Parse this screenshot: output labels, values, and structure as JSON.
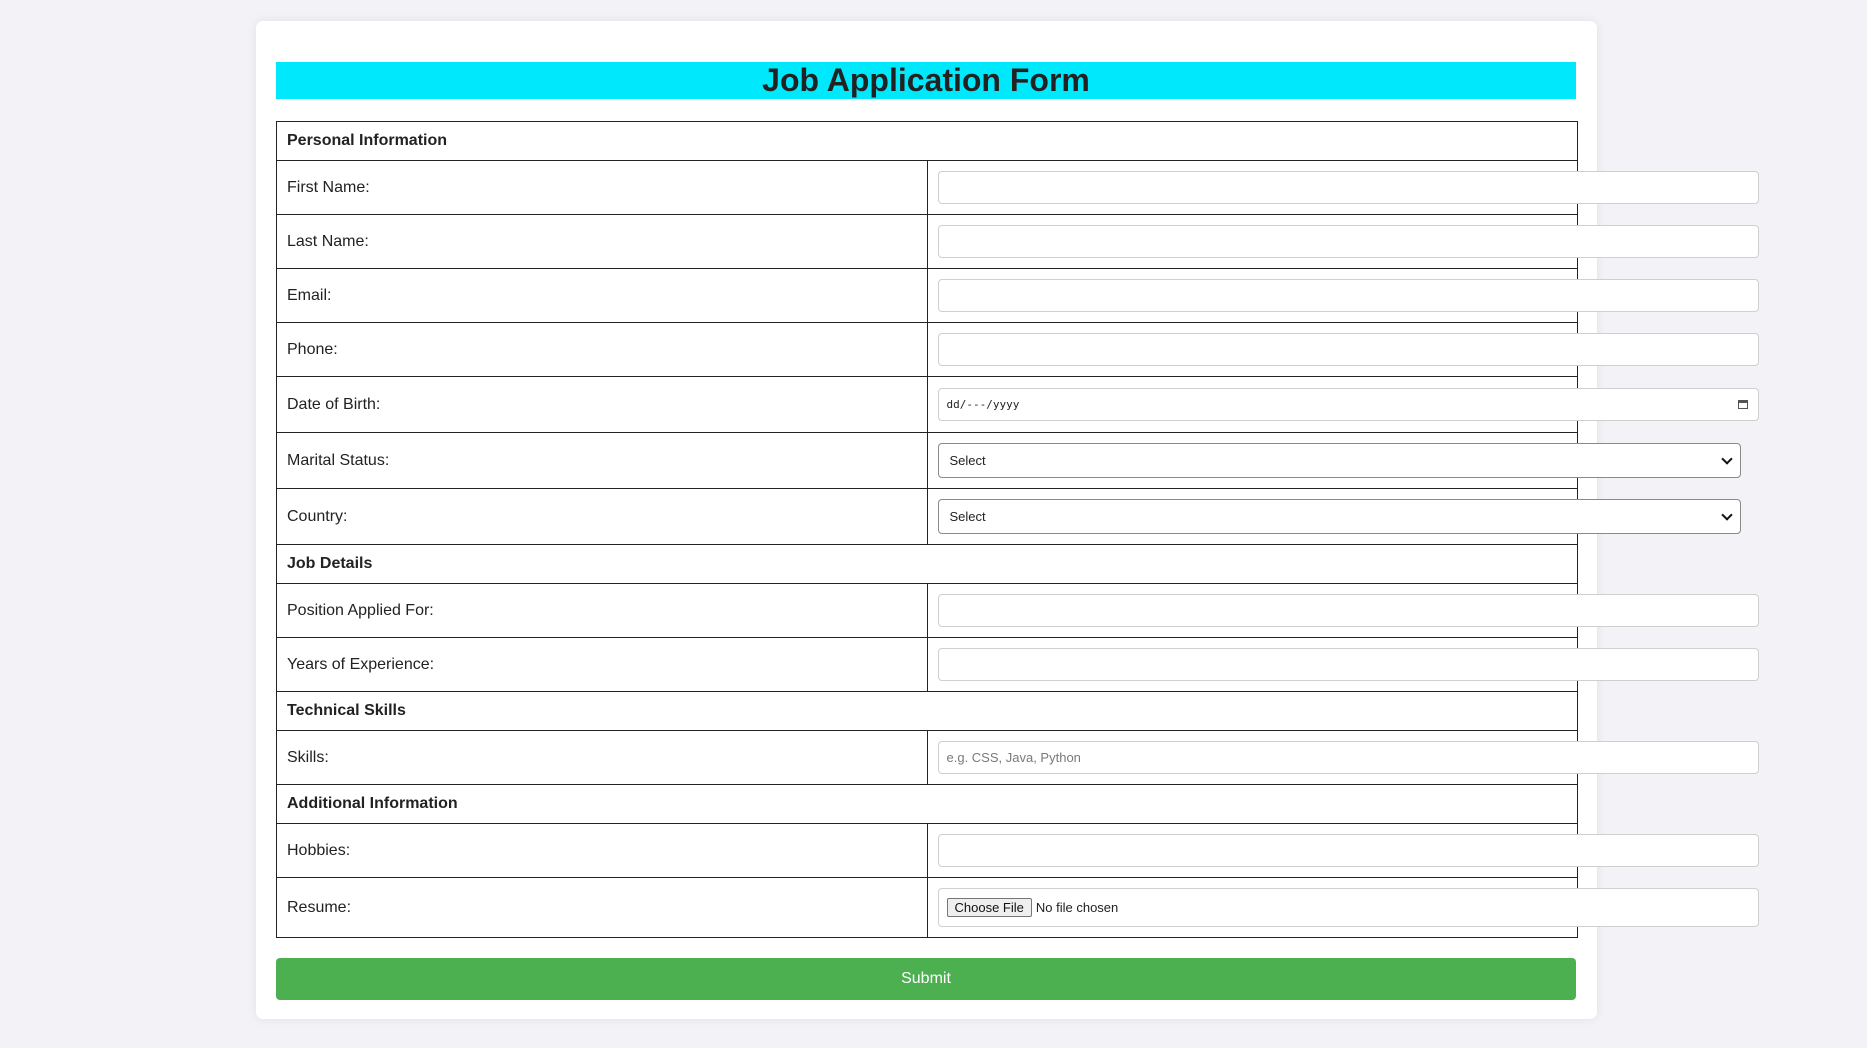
{
  "form": {
    "title": "Job Application Form",
    "submit_label": "Submit"
  },
  "sections": {
    "personal": "Personal Information",
    "job": "Job Details",
    "technical": "Technical Skills",
    "additional": "Additional Information"
  },
  "fields": {
    "first_name": {
      "label": "First Name:",
      "value": ""
    },
    "last_name": {
      "label": "Last Name:",
      "value": ""
    },
    "email": {
      "label": "Email:",
      "value": ""
    },
    "phone": {
      "label": "Phone:",
      "value": ""
    },
    "dob": {
      "label": "Date of Birth:",
      "placeholder": "dd/---/yyyy"
    },
    "marital_status": {
      "label": "Marital Status:",
      "selected": "Select"
    },
    "country": {
      "label": "Country:",
      "selected": "Select"
    },
    "position": {
      "label": "Position Applied For:",
      "value": ""
    },
    "experience": {
      "label": "Years of Experience:",
      "value": ""
    },
    "skills": {
      "label": "Skills:",
      "placeholder": "e.g. CSS, Java, Python"
    },
    "hobbies": {
      "label": "Hobbies:",
      "value": ""
    },
    "resume": {
      "label": "Resume:",
      "button": "Choose File",
      "status": "No file chosen"
    }
  },
  "colors": {
    "title_bg": "#00e8fc",
    "submit_bg": "#4caf50",
    "page_bg": "#f3f3f7"
  }
}
